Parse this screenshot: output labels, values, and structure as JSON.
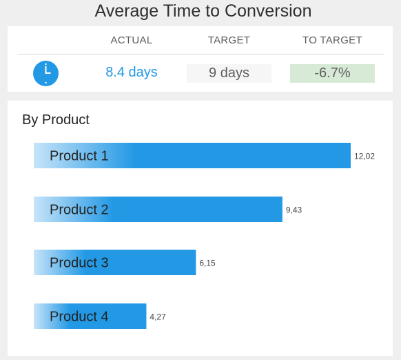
{
  "title": "Average Time to Conversion",
  "kpi": {
    "headers": {
      "actual": "ACTUAL",
      "target": "TARGET",
      "to_target": "TO TARGET"
    },
    "actual": "8.4 days",
    "target": "9 days",
    "to_target": "-6.7%",
    "icon": "clock-icon",
    "colors": {
      "accent": "#2399e5",
      "to_target_bg": "#d7ead6"
    }
  },
  "chart_data": {
    "type": "bar",
    "orientation": "horizontal",
    "title": "By Product",
    "categories": [
      "Product 1",
      "Product 2",
      "Product 3",
      "Product 4"
    ],
    "values": [
      12.02,
      9.43,
      6.15,
      4.27
    ],
    "value_labels": [
      "12,02",
      "9,43",
      "6,15",
      "4,27"
    ],
    "xlim": [
      0,
      12.02
    ],
    "grid": false,
    "colors": {
      "bar_start": "#c7e4f9",
      "bar_end": "#2399e5"
    }
  }
}
